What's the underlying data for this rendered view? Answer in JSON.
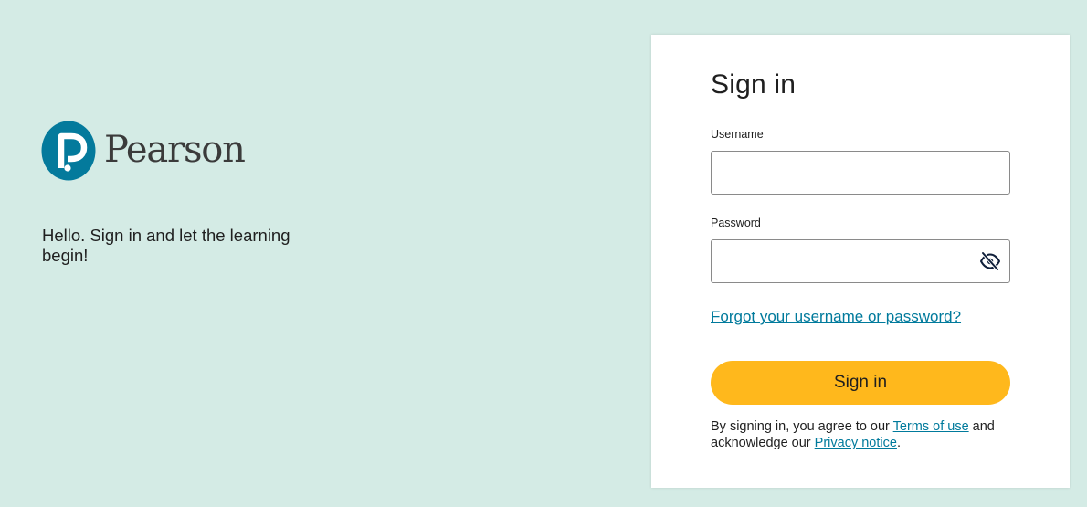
{
  "brand": {
    "name": "Pearson",
    "logo_color": "#047a9c",
    "tagline": "Hello. Sign in and let the learning begin!"
  },
  "signin": {
    "title": "Sign in",
    "username_label": "Username",
    "username_value": "",
    "password_label": "Password",
    "password_value": "",
    "password_toggle_icon": "eye-slash-icon",
    "forgot_link": "Forgot your username or password?",
    "button_label": "Sign in",
    "button_color": "#ffb81c",
    "legal": {
      "prefix": "By signing in, you agree to our ",
      "terms_link": "Terms of use",
      "middle": " and acknowledge our ",
      "privacy_link": "Privacy notice",
      "suffix": "."
    }
  },
  "colors": {
    "background": "#d4ebe5",
    "card": "#ffffff",
    "link": "#007a9c"
  }
}
